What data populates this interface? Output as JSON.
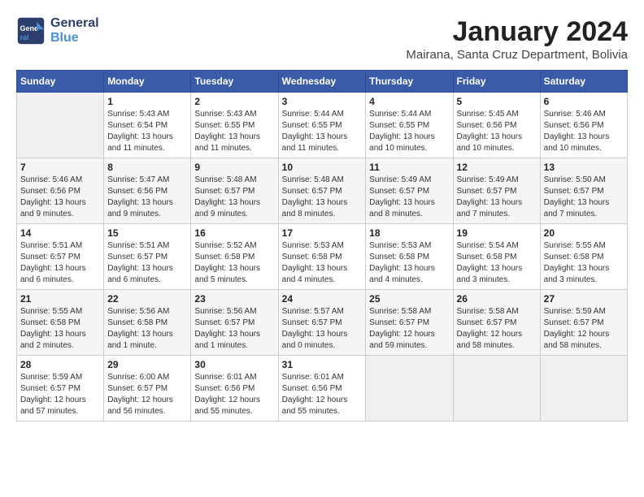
{
  "header": {
    "logo_line1": "General",
    "logo_line2": "Blue",
    "month": "January 2024",
    "location": "Mairana, Santa Cruz Department, Bolivia"
  },
  "weekdays": [
    "Sunday",
    "Monday",
    "Tuesday",
    "Wednesday",
    "Thursday",
    "Friday",
    "Saturday"
  ],
  "weeks": [
    [
      {
        "day": "",
        "sunrise": "",
        "sunset": "",
        "daylight": ""
      },
      {
        "day": "1",
        "sunrise": "Sunrise: 5:43 AM",
        "sunset": "Sunset: 6:54 PM",
        "daylight": "Daylight: 13 hours and 11 minutes."
      },
      {
        "day": "2",
        "sunrise": "Sunrise: 5:43 AM",
        "sunset": "Sunset: 6:55 PM",
        "daylight": "Daylight: 13 hours and 11 minutes."
      },
      {
        "day": "3",
        "sunrise": "Sunrise: 5:44 AM",
        "sunset": "Sunset: 6:55 PM",
        "daylight": "Daylight: 13 hours and 11 minutes."
      },
      {
        "day": "4",
        "sunrise": "Sunrise: 5:44 AM",
        "sunset": "Sunset: 6:55 PM",
        "daylight": "Daylight: 13 hours and 10 minutes."
      },
      {
        "day": "5",
        "sunrise": "Sunrise: 5:45 AM",
        "sunset": "Sunset: 6:56 PM",
        "daylight": "Daylight: 13 hours and 10 minutes."
      },
      {
        "day": "6",
        "sunrise": "Sunrise: 5:46 AM",
        "sunset": "Sunset: 6:56 PM",
        "daylight": "Daylight: 13 hours and 10 minutes."
      }
    ],
    [
      {
        "day": "7",
        "sunrise": "Sunrise: 5:46 AM",
        "sunset": "Sunset: 6:56 PM",
        "daylight": "Daylight: 13 hours and 9 minutes."
      },
      {
        "day": "8",
        "sunrise": "Sunrise: 5:47 AM",
        "sunset": "Sunset: 6:56 PM",
        "daylight": "Daylight: 13 hours and 9 minutes."
      },
      {
        "day": "9",
        "sunrise": "Sunrise: 5:48 AM",
        "sunset": "Sunset: 6:57 PM",
        "daylight": "Daylight: 13 hours and 9 minutes."
      },
      {
        "day": "10",
        "sunrise": "Sunrise: 5:48 AM",
        "sunset": "Sunset: 6:57 PM",
        "daylight": "Daylight: 13 hours and 8 minutes."
      },
      {
        "day": "11",
        "sunrise": "Sunrise: 5:49 AM",
        "sunset": "Sunset: 6:57 PM",
        "daylight": "Daylight: 13 hours and 8 minutes."
      },
      {
        "day": "12",
        "sunrise": "Sunrise: 5:49 AM",
        "sunset": "Sunset: 6:57 PM",
        "daylight": "Daylight: 13 hours and 7 minutes."
      },
      {
        "day": "13",
        "sunrise": "Sunrise: 5:50 AM",
        "sunset": "Sunset: 6:57 PM",
        "daylight": "Daylight: 13 hours and 7 minutes."
      }
    ],
    [
      {
        "day": "14",
        "sunrise": "Sunrise: 5:51 AM",
        "sunset": "Sunset: 6:57 PM",
        "daylight": "Daylight: 13 hours and 6 minutes."
      },
      {
        "day": "15",
        "sunrise": "Sunrise: 5:51 AM",
        "sunset": "Sunset: 6:57 PM",
        "daylight": "Daylight: 13 hours and 6 minutes."
      },
      {
        "day": "16",
        "sunrise": "Sunrise: 5:52 AM",
        "sunset": "Sunset: 6:58 PM",
        "daylight": "Daylight: 13 hours and 5 minutes."
      },
      {
        "day": "17",
        "sunrise": "Sunrise: 5:53 AM",
        "sunset": "Sunset: 6:58 PM",
        "daylight": "Daylight: 13 hours and 4 minutes."
      },
      {
        "day": "18",
        "sunrise": "Sunrise: 5:53 AM",
        "sunset": "Sunset: 6:58 PM",
        "daylight": "Daylight: 13 hours and 4 minutes."
      },
      {
        "day": "19",
        "sunrise": "Sunrise: 5:54 AM",
        "sunset": "Sunset: 6:58 PM",
        "daylight": "Daylight: 13 hours and 3 minutes."
      },
      {
        "day": "20",
        "sunrise": "Sunrise: 5:55 AM",
        "sunset": "Sunset: 6:58 PM",
        "daylight": "Daylight: 13 hours and 3 minutes."
      }
    ],
    [
      {
        "day": "21",
        "sunrise": "Sunrise: 5:55 AM",
        "sunset": "Sunset: 6:58 PM",
        "daylight": "Daylight: 13 hours and 2 minutes."
      },
      {
        "day": "22",
        "sunrise": "Sunrise: 5:56 AM",
        "sunset": "Sunset: 6:58 PM",
        "daylight": "Daylight: 13 hours and 1 minute."
      },
      {
        "day": "23",
        "sunrise": "Sunrise: 5:56 AM",
        "sunset": "Sunset: 6:57 PM",
        "daylight": "Daylight: 13 hours and 1 minutes."
      },
      {
        "day": "24",
        "sunrise": "Sunrise: 5:57 AM",
        "sunset": "Sunset: 6:57 PM",
        "daylight": "Daylight: 13 hours and 0 minutes."
      },
      {
        "day": "25",
        "sunrise": "Sunrise: 5:58 AM",
        "sunset": "Sunset: 6:57 PM",
        "daylight": "Daylight: 12 hours and 59 minutes."
      },
      {
        "day": "26",
        "sunrise": "Sunrise: 5:58 AM",
        "sunset": "Sunset: 6:57 PM",
        "daylight": "Daylight: 12 hours and 58 minutes."
      },
      {
        "day": "27",
        "sunrise": "Sunrise: 5:59 AM",
        "sunset": "Sunset: 6:57 PM",
        "daylight": "Daylight: 12 hours and 58 minutes."
      }
    ],
    [
      {
        "day": "28",
        "sunrise": "Sunrise: 5:59 AM",
        "sunset": "Sunset: 6:57 PM",
        "daylight": "Daylight: 12 hours and 57 minutes."
      },
      {
        "day": "29",
        "sunrise": "Sunrise: 6:00 AM",
        "sunset": "Sunset: 6:57 PM",
        "daylight": "Daylight: 12 hours and 56 minutes."
      },
      {
        "day": "30",
        "sunrise": "Sunrise: 6:01 AM",
        "sunset": "Sunset: 6:56 PM",
        "daylight": "Daylight: 12 hours and 55 minutes."
      },
      {
        "day": "31",
        "sunrise": "Sunrise: 6:01 AM",
        "sunset": "Sunset: 6:56 PM",
        "daylight": "Daylight: 12 hours and 55 minutes."
      },
      {
        "day": "",
        "sunrise": "",
        "sunset": "",
        "daylight": ""
      },
      {
        "day": "",
        "sunrise": "",
        "sunset": "",
        "daylight": ""
      },
      {
        "day": "",
        "sunrise": "",
        "sunset": "",
        "daylight": ""
      }
    ]
  ]
}
